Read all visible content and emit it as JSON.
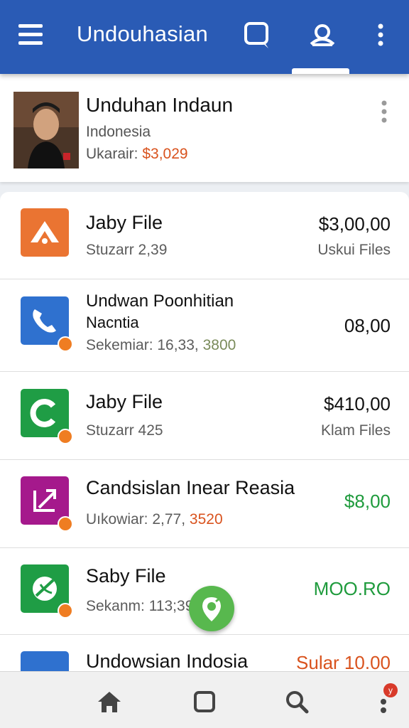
{
  "appbar": {
    "title": "Undouhasian",
    "icons": [
      "menu-icon",
      "chat-icon",
      "profile-icon",
      "more-vert-icon"
    ]
  },
  "profile": {
    "name": "Unduhan Indaun",
    "country": "Indonesia",
    "meta_label": "Ukarair: ",
    "meta_amount": "$3,029"
  },
  "items": [
    {
      "title": "Jaby File",
      "sub": "Stuzarr 2,39",
      "sub_hl": "",
      "price": "$3,00,00",
      "price_sub": "Uskui Files",
      "icon": "triangle-app-icon",
      "icon_color": "#ea7432"
    },
    {
      "title": "Undwan Poonhitian",
      "title2": "Nacntia",
      "sub": "Sekemiar: 16,33, ",
      "sub_hl": "3800",
      "price": "08,00",
      "price_sub": "",
      "icon": "phone-app-icon",
      "icon_color": "#2f71cf"
    },
    {
      "title": "Jaby File",
      "sub": "Stuzarr 425",
      "sub_hl": "",
      "price": "$410,00",
      "price_sub": "Klam Files",
      "icon": "c-app-icon",
      "icon_color": "#1f9d45"
    },
    {
      "title": "Candsislan Inear Reasia",
      "sub": "Uıkowiar: 2,77, ",
      "sub_hl": "3520",
      "price": "$8,00",
      "price_sub": "",
      "icon": "edit-box-app-icon",
      "icon_color": "#a5198c"
    },
    {
      "title": "Saby File",
      "sub": "Sekanm: 113;39",
      "sub_hl": "",
      "price": "MOO.RO",
      "price_sub": "",
      "icon": "leaf-app-icon",
      "icon_color": "#1f9d45"
    },
    {
      "title": "Undowsian Indosia",
      "sub": "",
      "sub_hl": "",
      "price": "Sular 10.00",
      "price_sub": "",
      "icon": "blue-app-icon",
      "icon_color": "#2f71cf"
    }
  ],
  "bottom_nav": {
    "icons": [
      "home-icon",
      "square-icon",
      "search-icon",
      "more-icon"
    ],
    "notification_count": "y"
  },
  "colors": {
    "appbar": "#2a5bb5",
    "accent_orange": "#d9531e",
    "accent_green": "#1f9b3d"
  }
}
